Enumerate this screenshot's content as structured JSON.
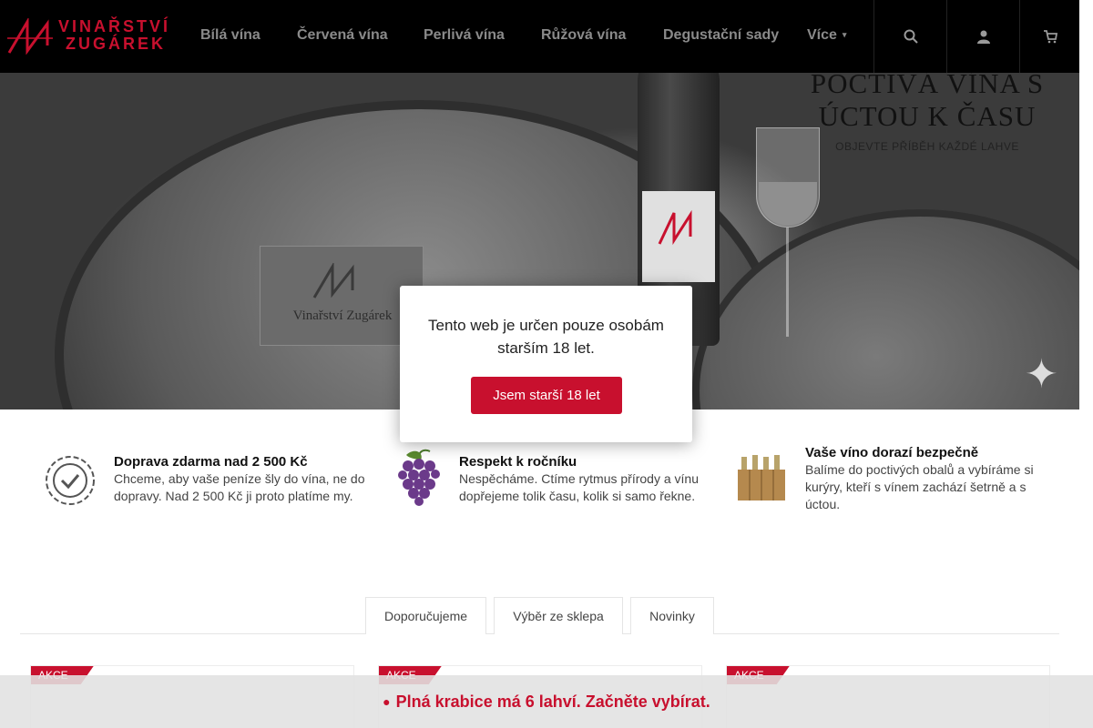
{
  "header": {
    "logo_text_line1": "VINAŘSTVÍ",
    "logo_text_line2": "ZUGÁREK",
    "nav": [
      {
        "label": "Bílá vína"
      },
      {
        "label": "Červená vína"
      },
      {
        "label": "Perlivá vína"
      },
      {
        "label": "Růžová vína"
      },
      {
        "label": "Degustační sady"
      },
      {
        "label": "Více"
      }
    ],
    "icons": [
      "search-icon",
      "user-icon",
      "cart-icon"
    ]
  },
  "hero": {
    "title": "POCTIVÁ VÍNA S ÚCTOU K ČASU",
    "subtitle": "OBJEVTE PŘÍBĚH KAŽDÉ LAHVE",
    "plaque_text": "Vinařství Zugárek"
  },
  "age_modal": {
    "text": "Tento web je určen pouze osobám starším 18 let.",
    "button": "Jsem starší 18 let"
  },
  "benefits": [
    {
      "title": "Doprava zdarma nad 2 500 Kč",
      "text": "Chceme, aby vaše peníze šly do vína, ne do dopravy. Nad 2 500 Kč ji proto platíme my.",
      "icon": "check-badge-icon"
    },
    {
      "title": "Respekt k ročníku",
      "text": "Nespěcháme. Ctíme rytmus přírody a vínu dopřejeme tolik času, kolik si samo řekne.",
      "icon": "grapes-icon"
    },
    {
      "title": "Vaše víno dorazí bezpečně",
      "text": "Balíme do poctivých obalů a vybíráme si kurýry, kteří s vínem zachází šetrně a s úctou.",
      "icon": "wine-box-icon"
    }
  ],
  "tabs": [
    {
      "label": "Doporučujeme"
    },
    {
      "label": "Výběr ze sklepa"
    },
    {
      "label": "Novinky"
    }
  ],
  "products": [
    {
      "badge": "AKCE"
    },
    {
      "badge": "AKCE"
    },
    {
      "badge": "AKCE"
    }
  ],
  "bottom_bar": {
    "text": "Plná krabice má 6 lahví. Začněte vybírat.",
    "icon": "info-icon"
  },
  "colors": {
    "accent": "#c8102e",
    "header_bg": "#000000",
    "nav_text": "#8a8a8a"
  }
}
